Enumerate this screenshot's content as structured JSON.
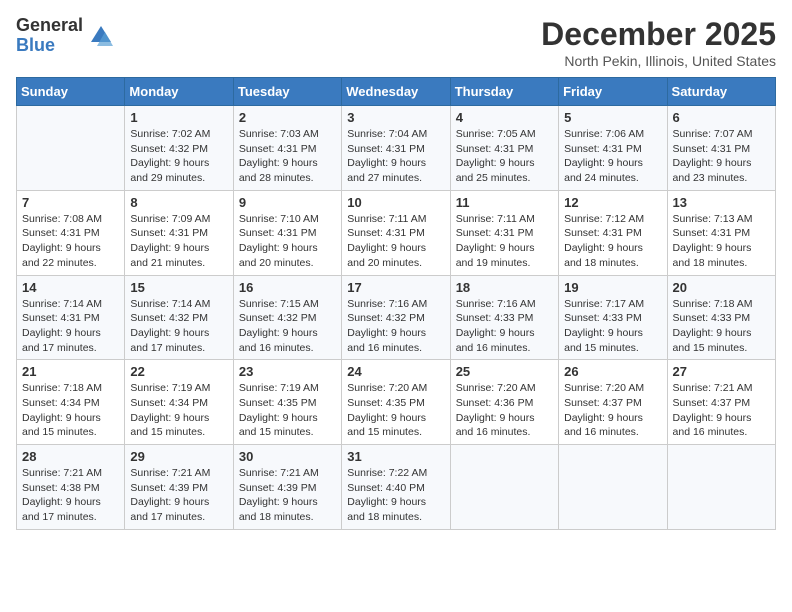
{
  "logo": {
    "general": "General",
    "blue": "Blue"
  },
  "header": {
    "month": "December 2025",
    "location": "North Pekin, Illinois, United States"
  },
  "weekdays": [
    "Sunday",
    "Monday",
    "Tuesday",
    "Wednesday",
    "Thursday",
    "Friday",
    "Saturday"
  ],
  "weeks": [
    [
      {
        "day": "",
        "sunrise": "",
        "sunset": "",
        "daylight": ""
      },
      {
        "day": "1",
        "sunrise": "Sunrise: 7:02 AM",
        "sunset": "Sunset: 4:32 PM",
        "daylight": "Daylight: 9 hours and 29 minutes."
      },
      {
        "day": "2",
        "sunrise": "Sunrise: 7:03 AM",
        "sunset": "Sunset: 4:31 PM",
        "daylight": "Daylight: 9 hours and 28 minutes."
      },
      {
        "day": "3",
        "sunrise": "Sunrise: 7:04 AM",
        "sunset": "Sunset: 4:31 PM",
        "daylight": "Daylight: 9 hours and 27 minutes."
      },
      {
        "day": "4",
        "sunrise": "Sunrise: 7:05 AM",
        "sunset": "Sunset: 4:31 PM",
        "daylight": "Daylight: 9 hours and 25 minutes."
      },
      {
        "day": "5",
        "sunrise": "Sunrise: 7:06 AM",
        "sunset": "Sunset: 4:31 PM",
        "daylight": "Daylight: 9 hours and 24 minutes."
      },
      {
        "day": "6",
        "sunrise": "Sunrise: 7:07 AM",
        "sunset": "Sunset: 4:31 PM",
        "daylight": "Daylight: 9 hours and 23 minutes."
      }
    ],
    [
      {
        "day": "7",
        "sunrise": "Sunrise: 7:08 AM",
        "sunset": "Sunset: 4:31 PM",
        "daylight": "Daylight: 9 hours and 22 minutes."
      },
      {
        "day": "8",
        "sunrise": "Sunrise: 7:09 AM",
        "sunset": "Sunset: 4:31 PM",
        "daylight": "Daylight: 9 hours and 21 minutes."
      },
      {
        "day": "9",
        "sunrise": "Sunrise: 7:10 AM",
        "sunset": "Sunset: 4:31 PM",
        "daylight": "Daylight: 9 hours and 20 minutes."
      },
      {
        "day": "10",
        "sunrise": "Sunrise: 7:11 AM",
        "sunset": "Sunset: 4:31 PM",
        "daylight": "Daylight: 9 hours and 20 minutes."
      },
      {
        "day": "11",
        "sunrise": "Sunrise: 7:11 AM",
        "sunset": "Sunset: 4:31 PM",
        "daylight": "Daylight: 9 hours and 19 minutes."
      },
      {
        "day": "12",
        "sunrise": "Sunrise: 7:12 AM",
        "sunset": "Sunset: 4:31 PM",
        "daylight": "Daylight: 9 hours and 18 minutes."
      },
      {
        "day": "13",
        "sunrise": "Sunrise: 7:13 AM",
        "sunset": "Sunset: 4:31 PM",
        "daylight": "Daylight: 9 hours and 18 minutes."
      }
    ],
    [
      {
        "day": "14",
        "sunrise": "Sunrise: 7:14 AM",
        "sunset": "Sunset: 4:31 PM",
        "daylight": "Daylight: 9 hours and 17 minutes."
      },
      {
        "day": "15",
        "sunrise": "Sunrise: 7:14 AM",
        "sunset": "Sunset: 4:32 PM",
        "daylight": "Daylight: 9 hours and 17 minutes."
      },
      {
        "day": "16",
        "sunrise": "Sunrise: 7:15 AM",
        "sunset": "Sunset: 4:32 PM",
        "daylight": "Daylight: 9 hours and 16 minutes."
      },
      {
        "day": "17",
        "sunrise": "Sunrise: 7:16 AM",
        "sunset": "Sunset: 4:32 PM",
        "daylight": "Daylight: 9 hours and 16 minutes."
      },
      {
        "day": "18",
        "sunrise": "Sunrise: 7:16 AM",
        "sunset": "Sunset: 4:33 PM",
        "daylight": "Daylight: 9 hours and 16 minutes."
      },
      {
        "day": "19",
        "sunrise": "Sunrise: 7:17 AM",
        "sunset": "Sunset: 4:33 PM",
        "daylight": "Daylight: 9 hours and 15 minutes."
      },
      {
        "day": "20",
        "sunrise": "Sunrise: 7:18 AM",
        "sunset": "Sunset: 4:33 PM",
        "daylight": "Daylight: 9 hours and 15 minutes."
      }
    ],
    [
      {
        "day": "21",
        "sunrise": "Sunrise: 7:18 AM",
        "sunset": "Sunset: 4:34 PM",
        "daylight": "Daylight: 9 hours and 15 minutes."
      },
      {
        "day": "22",
        "sunrise": "Sunrise: 7:19 AM",
        "sunset": "Sunset: 4:34 PM",
        "daylight": "Daylight: 9 hours and 15 minutes."
      },
      {
        "day": "23",
        "sunrise": "Sunrise: 7:19 AM",
        "sunset": "Sunset: 4:35 PM",
        "daylight": "Daylight: 9 hours and 15 minutes."
      },
      {
        "day": "24",
        "sunrise": "Sunrise: 7:20 AM",
        "sunset": "Sunset: 4:35 PM",
        "daylight": "Daylight: 9 hours and 15 minutes."
      },
      {
        "day": "25",
        "sunrise": "Sunrise: 7:20 AM",
        "sunset": "Sunset: 4:36 PM",
        "daylight": "Daylight: 9 hours and 16 minutes."
      },
      {
        "day": "26",
        "sunrise": "Sunrise: 7:20 AM",
        "sunset": "Sunset: 4:37 PM",
        "daylight": "Daylight: 9 hours and 16 minutes."
      },
      {
        "day": "27",
        "sunrise": "Sunrise: 7:21 AM",
        "sunset": "Sunset: 4:37 PM",
        "daylight": "Daylight: 9 hours and 16 minutes."
      }
    ],
    [
      {
        "day": "28",
        "sunrise": "Sunrise: 7:21 AM",
        "sunset": "Sunset: 4:38 PM",
        "daylight": "Daylight: 9 hours and 17 minutes."
      },
      {
        "day": "29",
        "sunrise": "Sunrise: 7:21 AM",
        "sunset": "Sunset: 4:39 PM",
        "daylight": "Daylight: 9 hours and 17 minutes."
      },
      {
        "day": "30",
        "sunrise": "Sunrise: 7:21 AM",
        "sunset": "Sunset: 4:39 PM",
        "daylight": "Daylight: 9 hours and 18 minutes."
      },
      {
        "day": "31",
        "sunrise": "Sunrise: 7:22 AM",
        "sunset": "Sunset: 4:40 PM",
        "daylight": "Daylight: 9 hours and 18 minutes."
      },
      {
        "day": "",
        "sunrise": "",
        "sunset": "",
        "daylight": ""
      },
      {
        "day": "",
        "sunrise": "",
        "sunset": "",
        "daylight": ""
      },
      {
        "day": "",
        "sunrise": "",
        "sunset": "",
        "daylight": ""
      }
    ]
  ]
}
